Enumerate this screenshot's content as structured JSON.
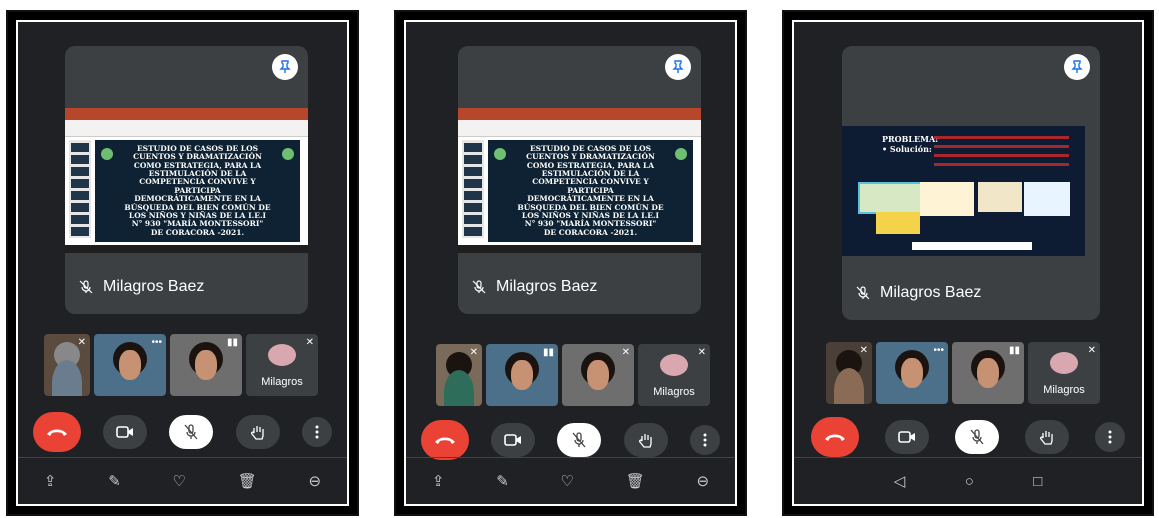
{
  "panels": [
    {
      "speaker": "Milagros Baez",
      "slide_text": "ESTUDIO DE CASOS DE LOS\nCUENTOS Y DRAMATIZACIÓN\nCOMO ESTRATEGIA, PARA LA\nESTIMULACIÓN DE LA\nCOMPETENCIA CONVIVE Y\nPARTICIPA\nDEMOCRÁTICAMENTE EN LA\nBÚSQUEDA DEL BIEN COMÚN DE\nLOS NIÑOS Y NIÑAS DE LA I.E.I\nN° 930 \"MARÍA MONTESSORI\"\nDE CORACORA -2021.",
      "thumb_name": "Milagros"
    },
    {
      "speaker": "Milagros Baez",
      "slide_text": "ESTUDIO DE CASOS DE LOS\nCUENTOS Y DRAMATIZACIÓN\nCOMO ESTRATEGIA, PARA LA\nESTIMULACIÓN DE LA\nCOMPETENCIA CONVIVE Y\nPARTICIPA\nDEMOCRÁTICAMENTE EN LA\nBÚSQUEDA DEL BIEN COMÚN DE\nLOS NIÑOS Y NIÑAS DE LA I.E.I\nN° 930 \"MARÍA MONTESSORI\"\nDE CORACORA -2021.",
      "thumb_name": "Milagros"
    },
    {
      "speaker": "Milagros Baez",
      "slide_text": "PROBLEMA:\n• Solución:",
      "thumb_name": "Milagros"
    }
  ],
  "nav_icons_1": [
    "share-icon",
    "edit-icon",
    "heart-icon",
    "delete-icon",
    "more-icon"
  ],
  "nav_icons_3": [
    "back-icon",
    "home-icon",
    "recents-icon"
  ],
  "colors": {
    "end_call": "#ea4335",
    "screen_bg": "#202124",
    "tile_bg": "#3c4043"
  }
}
